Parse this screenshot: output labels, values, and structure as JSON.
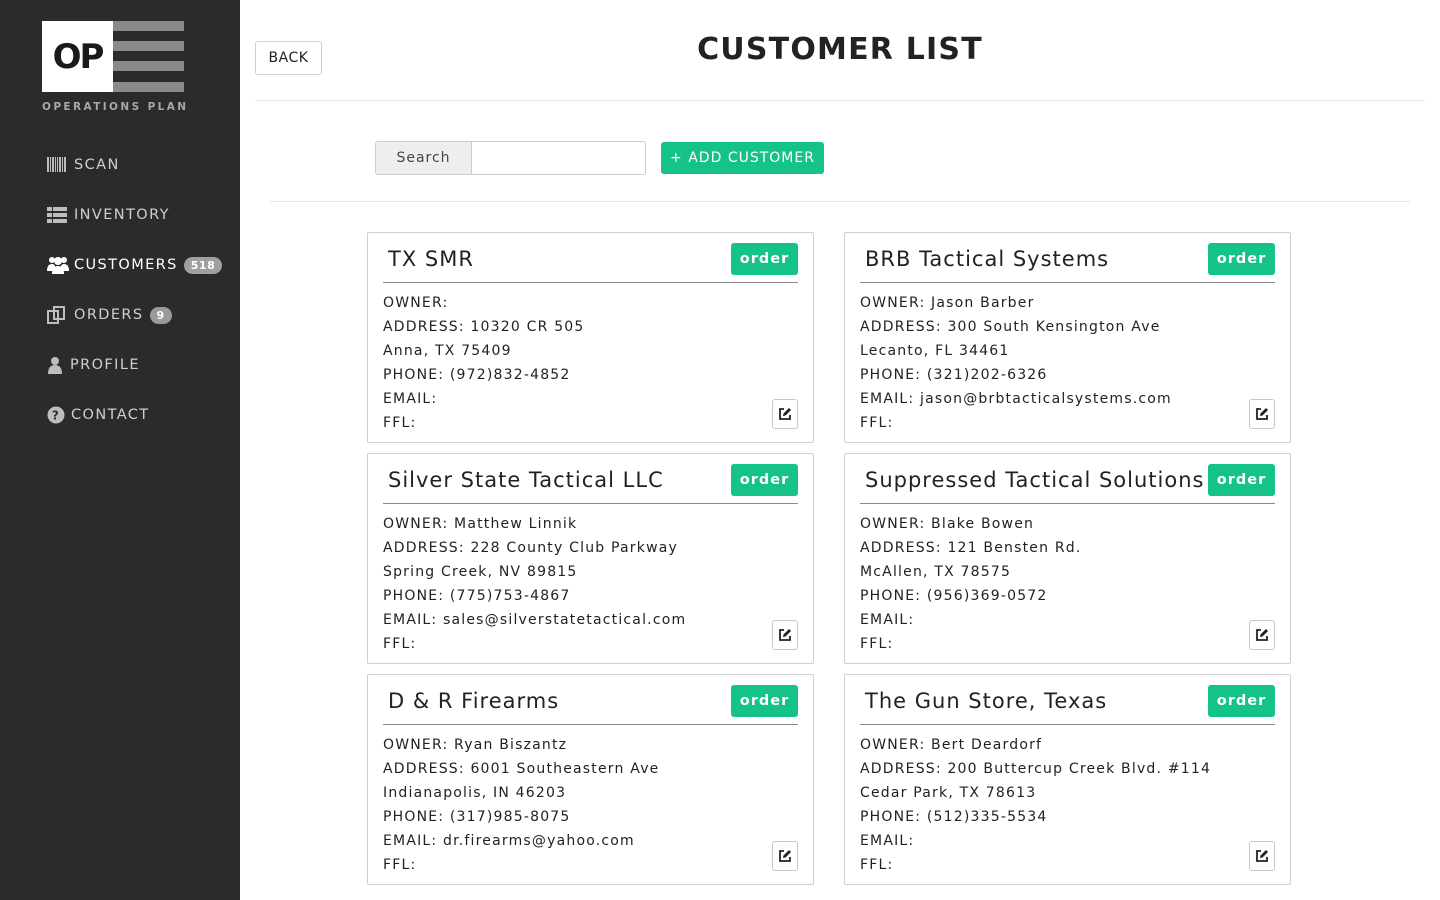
{
  "brand": {
    "logo_letters": "OP",
    "logo_text": "OPERATIONS PLAN"
  },
  "nav": [
    {
      "label": "SCAN",
      "icon": "barcode-icon",
      "badge": null,
      "active": false
    },
    {
      "label": "INVENTORY",
      "icon": "list-icon",
      "badge": null,
      "active": false
    },
    {
      "label": "CUSTOMERS",
      "icon": "users-icon",
      "badge": "518",
      "active": true
    },
    {
      "label": "ORDERS",
      "icon": "orders-icon",
      "badge": "9",
      "active": false
    },
    {
      "label": "PROFILE",
      "icon": "user-icon",
      "badge": null,
      "active": false
    },
    {
      "label": "CONTACT",
      "icon": "question-icon",
      "badge": null,
      "active": false
    }
  ],
  "header": {
    "back_label": "BACK",
    "title": "CUSTOMER LIST"
  },
  "search": {
    "label": "Search",
    "value": "",
    "placeholder": ""
  },
  "add_customer_label": "+ ADD CUSTOMER",
  "order_label": "order",
  "colors": {
    "accent": "#15c386",
    "sidebar": "#2b2b2b"
  },
  "customers": [
    {
      "name": "TX SMR",
      "owner": "OWNER:",
      "address": "ADDRESS: 10320 CR 505",
      "city": "Anna, TX 75409",
      "phone": "PHONE: (972)832-4852",
      "email": "EMAIL:",
      "ffl": "FFL:"
    },
    {
      "name": "BRB Tactical Systems",
      "owner": "OWNER: Jason Barber",
      "address": "ADDRESS: 300 South Kensington Ave",
      "city": "Lecanto, FL 34461",
      "phone": "PHONE: (321)202-6326",
      "email": "EMAIL: jason@brbtacticalsystems.com",
      "ffl": "FFL:"
    },
    {
      "name": "Silver State Tactical LLC",
      "owner": "OWNER: Matthew Linnik",
      "address": "ADDRESS: 228 County Club Parkway",
      "city": "Spring Creek, NV 89815",
      "phone": "PHONE: (775)753-4867",
      "email": "EMAIL: sales@silverstatetactical.com",
      "ffl": "FFL:"
    },
    {
      "name": "Suppressed Tactical Solutions",
      "owner": "OWNER: Blake Bowen",
      "address": "ADDRESS: 121 Bensten Rd.",
      "city": "McAllen, TX 78575",
      "phone": "PHONE: (956)369-0572",
      "email": "EMAIL:",
      "ffl": "FFL:"
    },
    {
      "name": "D & R Firearms",
      "owner": "OWNER: Ryan Biszantz",
      "address": "ADDRESS: 6001 Southeastern Ave",
      "city": "Indianapolis, IN 46203",
      "phone": "PHONE: (317)985-8075",
      "email": "EMAIL: dr.firearms@yahoo.com",
      "ffl": "FFL:"
    },
    {
      "name": "The Gun Store, Texas",
      "owner": "OWNER: Bert Deardorf",
      "address": "ADDRESS: 200 Buttercup Creek Blvd. #114",
      "city": "Cedar Park, TX 78613",
      "phone": "PHONE: (512)335-5534",
      "email": "EMAIL:",
      "ffl": "FFL:"
    }
  ]
}
